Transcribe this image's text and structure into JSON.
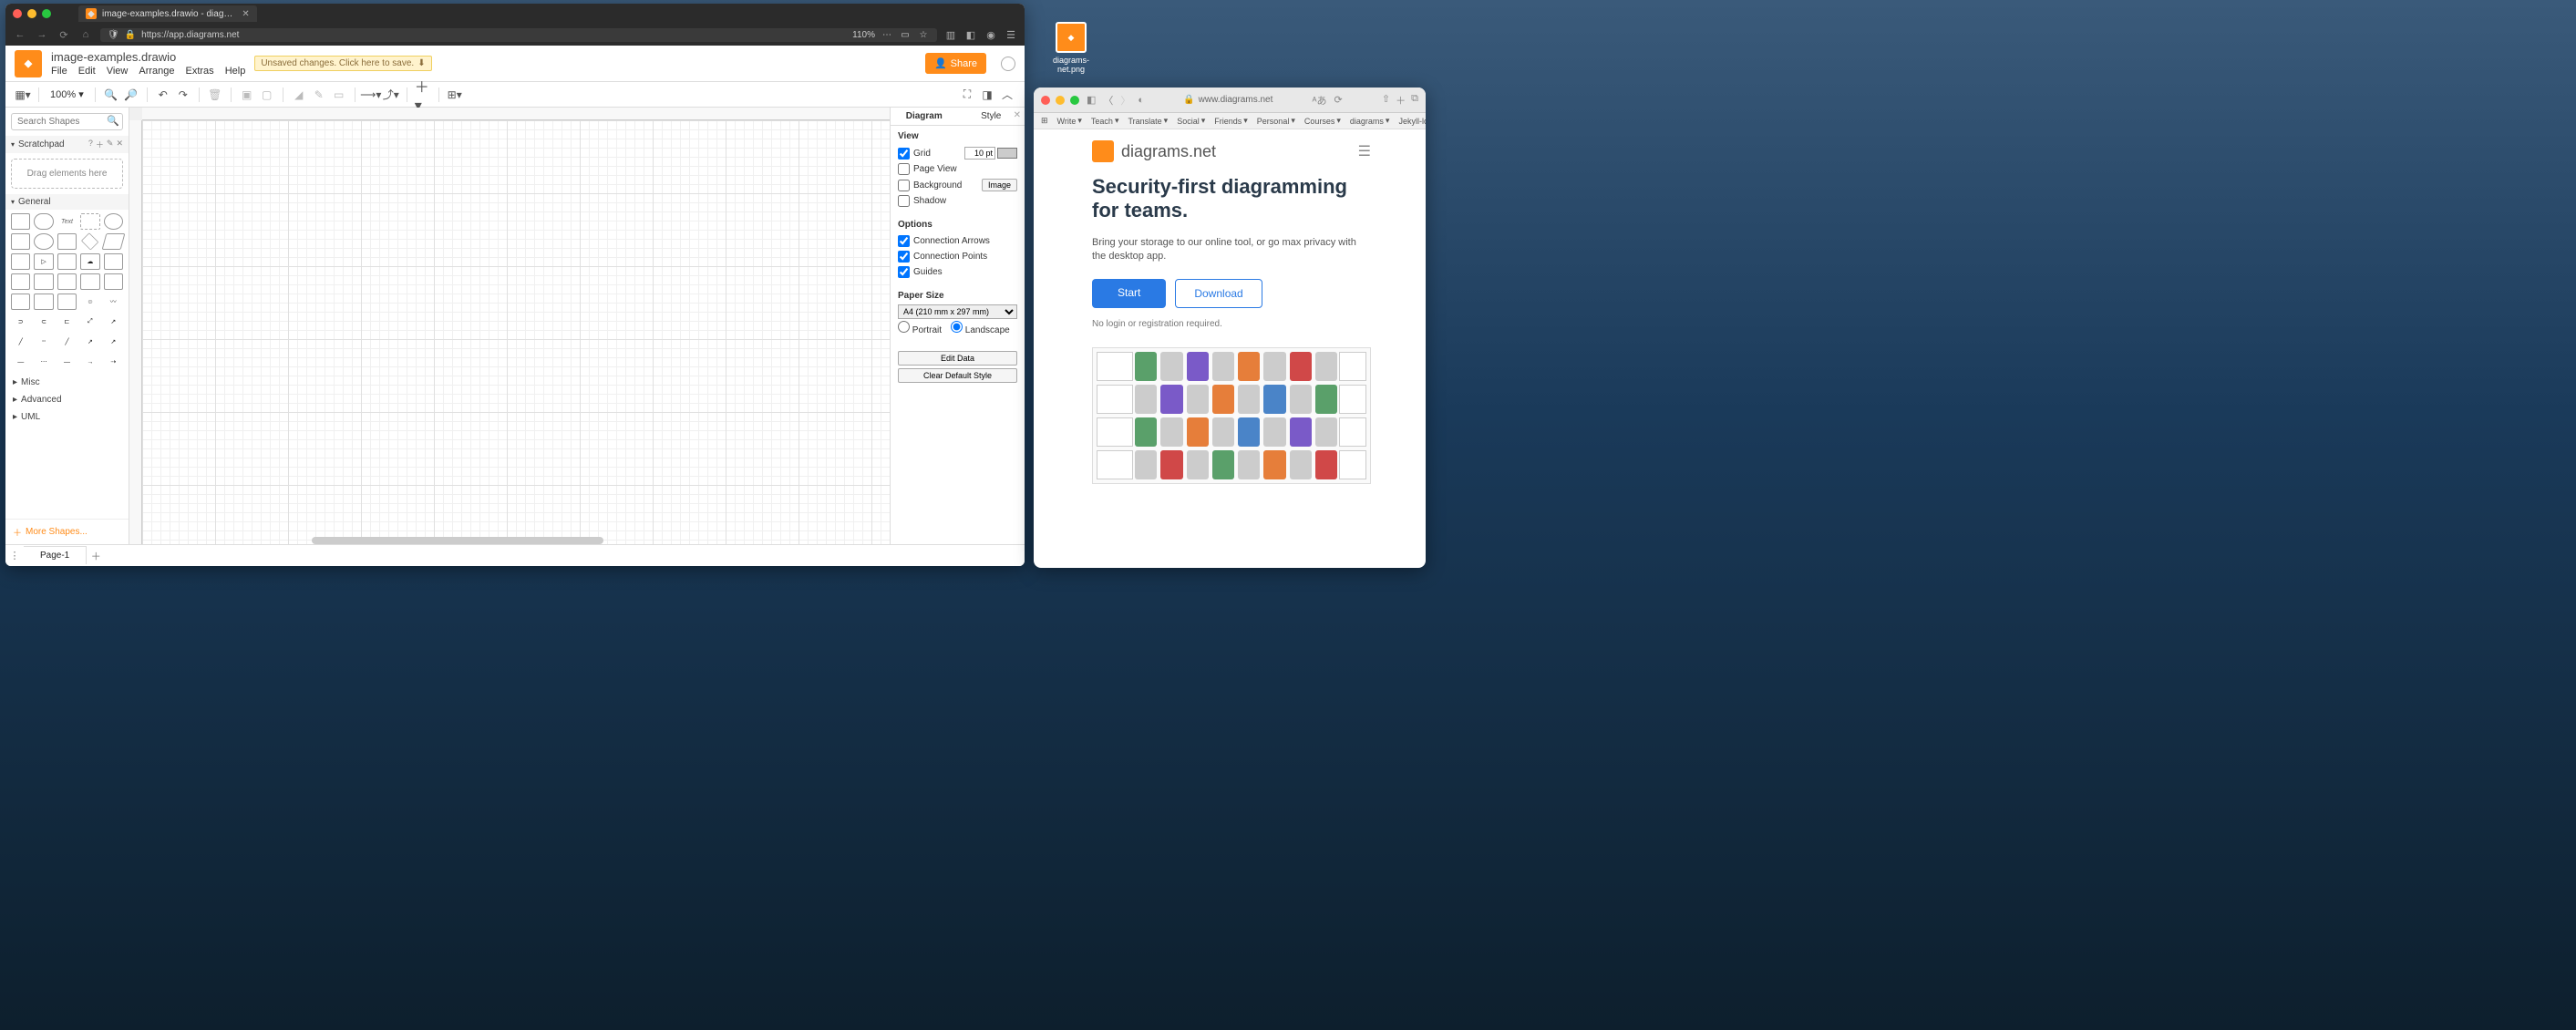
{
  "desktop_file": {
    "name": "diagrams-net.png"
  },
  "browser_left": {
    "tab_title": "image-examples.drawio - diag…",
    "url": "https://app.diagrams.net",
    "zoom": "110%"
  },
  "app": {
    "doc_title": "image-examples.drawio",
    "menus": [
      "File",
      "Edit",
      "View",
      "Arrange",
      "Extras",
      "Help"
    ],
    "unsaved_msg": "Unsaved changes. Click here to save.",
    "share_label": "Share"
  },
  "toolbar": {
    "zoom": "100%"
  },
  "left_panel": {
    "search_placeholder": "Search Shapes",
    "scratchpad_label": "Scratchpad",
    "dropzone": "Drag elements here",
    "general_label": "General",
    "cats": [
      "Misc",
      "Advanced",
      "UML"
    ],
    "more_shapes": "More Shapes..."
  },
  "right_panel": {
    "tabs": {
      "diagram": "Diagram",
      "style": "Style"
    },
    "view_h": "View",
    "grid": {
      "label": "Grid",
      "checked": true,
      "size": "10 pt"
    },
    "page_view": {
      "label": "Page View",
      "checked": false
    },
    "background": {
      "label": "Background",
      "checked": false,
      "image_btn": "Image"
    },
    "shadow": {
      "label": "Shadow",
      "checked": false
    },
    "options_h": "Options",
    "conn_arrows": {
      "label": "Connection Arrows",
      "checked": true
    },
    "conn_points": {
      "label": "Connection Points",
      "checked": true
    },
    "guides": {
      "label": "Guides",
      "checked": true
    },
    "paper_h": "Paper Size",
    "paper_value": "A4 (210 mm x 297 mm)",
    "portrait": "Portrait",
    "landscape": "Landscape",
    "orientation": "landscape",
    "edit_data": "Edit Data",
    "clear_style": "Clear Default Style"
  },
  "page_tabs": {
    "page1": "Page-1"
  },
  "browser_right": {
    "url": "www.diagrams.net",
    "bookmarks": [
      "Write",
      "Teach",
      "Translate",
      "Social",
      "Friends",
      "Personal",
      "Courses",
      "diagrams",
      "Jekyll-localhost"
    ],
    "site_name": "diagrams.net",
    "hero": "Security-first diagramming for teams.",
    "sub": "Bring your storage to our online tool, or go max privacy with the desktop app.",
    "start": "Start",
    "download": "Download",
    "noreg": "No login or registration required."
  }
}
